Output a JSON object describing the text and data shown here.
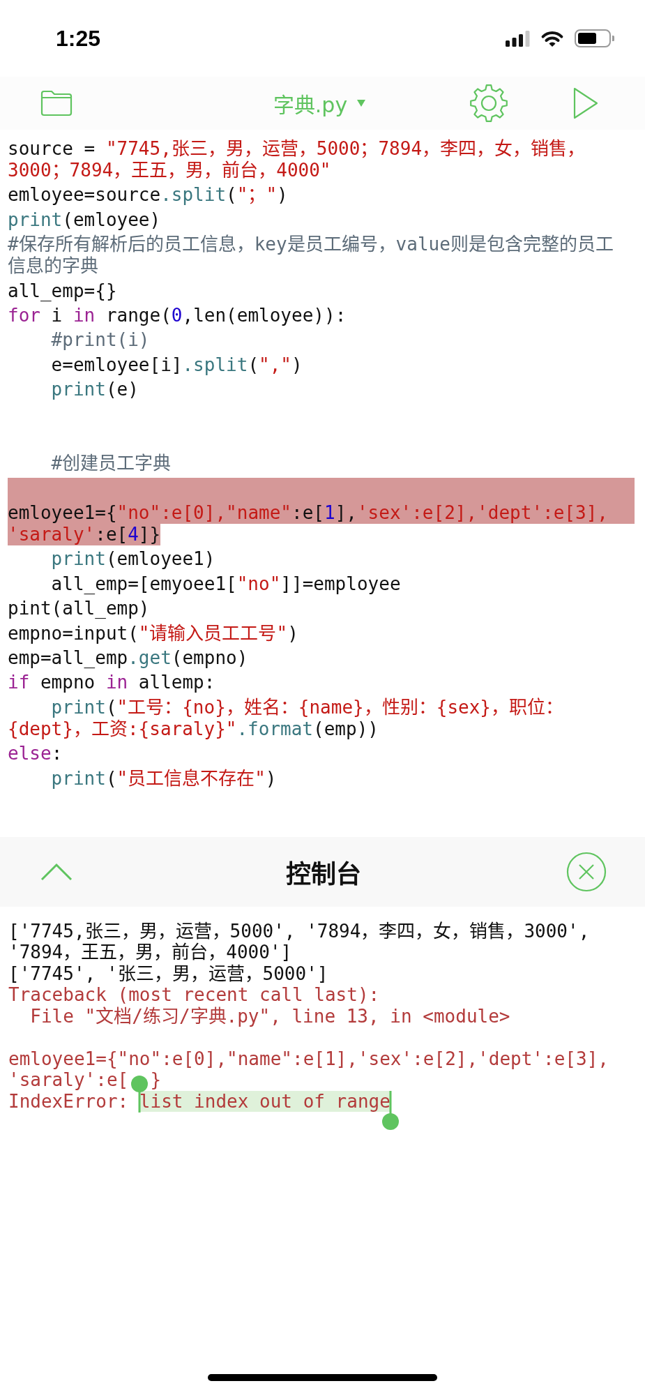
{
  "status_bar": {
    "time": "1:25"
  },
  "toolbar": {
    "title": "字典.py"
  },
  "editor": {
    "lines": [
      {
        "kind": "code",
        "highlighted": false,
        "display_lines": [
          {
            "tokens": [
              {
                "kind": "plain",
                "text": "source = "
              },
              {
                "kind": "string",
                "text": "\"7745,张三，男，运营，5000；7894，李四，女，销售，"
              }
            ]
          },
          {
            "tokens": [
              {
                "kind": "string",
                "text": "3000；7894，王五，男，前台，4000\""
              }
            ]
          }
        ]
      },
      {
        "kind": "code",
        "highlighted": false,
        "display_lines": [
          {
            "tokens": [
              {
                "kind": "plain",
                "text": "emloyee=source"
              },
              {
                "kind": "builtin",
                "text": ".split"
              },
              {
                "kind": "plain",
                "text": "("
              },
              {
                "kind": "string",
                "text": "\"；\""
              },
              {
                "kind": "plain",
                "text": ")"
              }
            ]
          }
        ]
      },
      {
        "kind": "code",
        "highlighted": false,
        "display_lines": [
          {
            "tokens": [
              {
                "kind": "builtin",
                "text": "print"
              },
              {
                "kind": "plain",
                "text": "(emloyee)"
              }
            ]
          }
        ]
      },
      {
        "kind": "code",
        "highlighted": false,
        "display_lines": [
          {
            "tokens": [
              {
                "kind": "comment",
                "text": "#保存所有解析后的员工信息，key是员工编号，value则是包含完整的员工"
              }
            ]
          },
          {
            "tokens": [
              {
                "kind": "comment",
                "text": "信息的字典"
              }
            ]
          }
        ]
      },
      {
        "kind": "code",
        "highlighted": false,
        "display_lines": [
          {
            "tokens": [
              {
                "kind": "plain",
                "text": "all_emp={}"
              }
            ]
          }
        ]
      },
      {
        "kind": "code",
        "highlighted": false,
        "display_lines": [
          {
            "tokens": [
              {
                "kind": "keyword",
                "text": "for"
              },
              {
                "kind": "plain",
                "text": " i "
              },
              {
                "kind": "keyword",
                "text": "in"
              },
              {
                "kind": "plain",
                "text": " range("
              },
              {
                "kind": "number",
                "text": "0"
              },
              {
                "kind": "plain",
                "text": ",len(emloyee)):"
              }
            ]
          }
        ]
      },
      {
        "kind": "indented",
        "children": [
          {
            "kind": "code",
            "highlighted": false,
            "display_lines": [
              {
                "tokens": [
                  {
                    "kind": "comment",
                    "text": "#print(i)"
                  }
                ]
              }
            ]
          },
          {
            "kind": "code",
            "highlighted": false,
            "display_lines": [
              {
                "tokens": [
                  {
                    "kind": "plain",
                    "text": "e=emloyee[i]"
                  },
                  {
                    "kind": "builtin",
                    "text": ".split"
                  },
                  {
                    "kind": "plain",
                    "text": "("
                  },
                  {
                    "kind": "string",
                    "text": "\",\""
                  },
                  {
                    "kind": "plain",
                    "text": ")"
                  }
                ]
              }
            ]
          },
          {
            "kind": "code",
            "highlighted": false,
            "display_lines": [
              {
                "tokens": [
                  {
                    "kind": "builtin",
                    "text": "print"
                  },
                  {
                    "kind": "plain",
                    "text": "(e)"
                  }
                ]
              }
            ]
          },
          {
            "kind": "blank",
            "highlighted": false
          },
          {
            "kind": "blank",
            "highlighted": false
          },
          {
            "kind": "code",
            "highlighted": false,
            "display_lines": [
              {
                "tokens": [
                  {
                    "kind": "comment",
                    "text": "#创建员工字典"
                  }
                ]
              }
            ]
          }
        ]
      },
      {
        "kind": "blank",
        "highlighted": true
      },
      {
        "kind": "code",
        "highlighted": true,
        "display_lines": [
          {
            "tokens": [
              {
                "kind": "plain",
                "text": "emloyee1={"
              },
              {
                "kind": "string",
                "text": "\"no\":e[0],\"name\""
              },
              {
                "kind": "plain",
                "text": ":e["
              },
              {
                "kind": "number",
                "text": "1"
              },
              {
                "kind": "plain",
                "text": "],"
              },
              {
                "kind": "string",
                "text": "'sex':e[2],'dept':e[3],"
              }
            ]
          },
          {
            "tokens": [
              {
                "kind": "string",
                "text": "'saraly'"
              },
              {
                "kind": "plain",
                "text": ":e["
              },
              {
                "kind": "number",
                "text": "4"
              },
              {
                "kind": "plain",
                "text": "]}"
              }
            ]
          }
        ]
      },
      {
        "kind": "indented",
        "children": [
          {
            "kind": "code",
            "highlighted": false,
            "display_lines": [
              {
                "tokens": [
                  {
                    "kind": "builtin",
                    "text": "print"
                  },
                  {
                    "kind": "plain",
                    "text": "(emloyee1)"
                  }
                ]
              }
            ]
          },
          {
            "kind": "code",
            "highlighted": false,
            "display_lines": [
              {
                "tokens": [
                  {
                    "kind": "plain",
                    "text": "all_emp=[emyoee1["
                  },
                  {
                    "kind": "string",
                    "text": "\"no\""
                  },
                  {
                    "kind": "plain",
                    "text": "]]=employee"
                  }
                ]
              }
            ]
          }
        ]
      },
      {
        "kind": "code",
        "highlighted": false,
        "display_lines": [
          {
            "tokens": [
              {
                "kind": "plain",
                "text": "pint(all_emp)"
              }
            ]
          }
        ]
      },
      {
        "kind": "code",
        "highlighted": false,
        "display_lines": [
          {
            "tokens": [
              {
                "kind": "plain",
                "text": "empno=input("
              },
              {
                "kind": "string",
                "text": "\"请输入员工工号\""
              },
              {
                "kind": "plain",
                "text": ")"
              }
            ]
          }
        ]
      },
      {
        "kind": "code",
        "highlighted": false,
        "display_lines": [
          {
            "tokens": [
              {
                "kind": "plain",
                "text": "emp=all_emp"
              },
              {
                "kind": "builtin",
                "text": ".get"
              },
              {
                "kind": "plain",
                "text": "(empno)"
              }
            ]
          }
        ]
      },
      {
        "kind": "code",
        "highlighted": false,
        "display_lines": [
          {
            "tokens": [
              {
                "kind": "keyword",
                "text": "if"
              },
              {
                "kind": "plain",
                "text": " empno "
              },
              {
                "kind": "keyword",
                "text": "in"
              },
              {
                "kind": "plain",
                "text": " allemp:"
              }
            ]
          }
        ]
      },
      {
        "kind": "indented",
        "children": [
          {
            "kind": "code",
            "highlighted": false,
            "display_lines": [
              {
                "tokens": [
                  {
                    "kind": "builtin",
                    "text": "print"
                  },
                  {
                    "kind": "plain",
                    "text": "("
                  },
                  {
                    "kind": "string",
                    "text": "\"工号：{no}，姓名：{name}，性别：{sex}，职位："
                  }
                ]
              },
              {
                "tokens": [
                  {
                    "kind": "string",
                    "text": "{dept}，工资:{saraly}\""
                  },
                  {
                    "kind": "builtin",
                    "text": ".format"
                  },
                  {
                    "kind": "plain",
                    "text": "(emp))"
                  }
                ]
              }
            ]
          }
        ]
      },
      {
        "kind": "code",
        "highlighted": false,
        "display_lines": [
          {
            "tokens": [
              {
                "kind": "keyword",
                "text": "else"
              },
              {
                "kind": "plain",
                "text": ":"
              }
            ]
          }
        ]
      },
      {
        "kind": "indented",
        "children": [
          {
            "kind": "code",
            "highlighted": false,
            "display_lines": [
              {
                "tokens": [
                  {
                    "kind": "builtin",
                    "text": "print"
                  },
                  {
                    "kind": "plain",
                    "text": "("
                  },
                  {
                    "kind": "string",
                    "text": "\"员工信息不存在\""
                  },
                  {
                    "kind": "plain",
                    "text": ")"
                  }
                ]
              }
            ]
          }
        ]
      }
    ]
  },
  "console": {
    "title": "控制台",
    "lines": [
      {
        "kind": "output",
        "display_lines": [
          {
            "parts": [
              "['7745,张三，男，运营，5000', '7894，李四，女，销售，3000',"
            ]
          },
          {
            "parts": [
              "'7894，王五，男，前台，4000']"
            ]
          }
        ]
      },
      {
        "kind": "output",
        "display_lines": [
          {
            "parts": [
              "['7745', '张三，男，运营，5000']"
            ]
          }
        ]
      },
      {
        "kind": "error",
        "display_lines": [
          {
            "parts": [
              "Traceback (most recent call last):"
            ]
          }
        ]
      },
      {
        "kind": "error",
        "display_lines": [
          {
            "parts": [
              "  File \"文档/练习/字典.py\", line 13, in <module>"
            ]
          }
        ]
      },
      {
        "kind": "source",
        "display_lines": [
          {
            "parts": [
              "emloyee1={\"no\":e[0],\"name\":e[1],'sex':e[2],'dept':e[3],"
            ]
          },
          {
            "parts": [
              "'saraly':e[",
              "}"
            ]
          }
        ]
      },
      {
        "kind": "exception",
        "segments": [
          {
            "text": "IndexError: ",
            "selected": false
          },
          {
            "text": "list index out of range",
            "selected": true
          }
        ]
      }
    ]
  }
}
